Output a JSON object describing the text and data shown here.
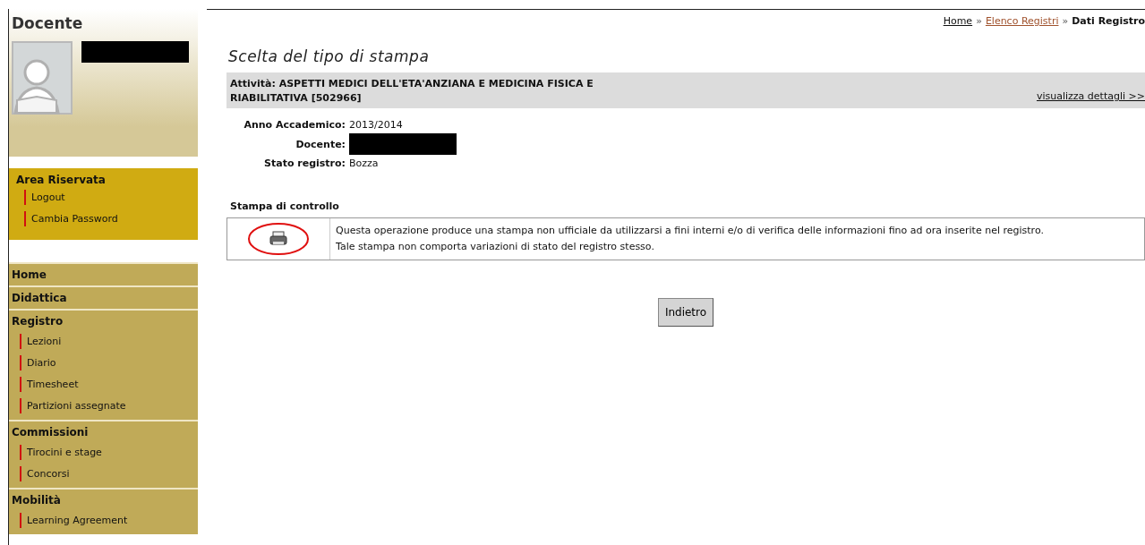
{
  "sidebar": {
    "title": "Docente",
    "reserved_area": {
      "title": "Area Riservata",
      "items": [
        "Logout",
        "Cambia Password"
      ]
    },
    "menu": [
      {
        "label": "Home"
      },
      {
        "label": "Didattica"
      },
      {
        "label": "Registro",
        "children": [
          "Lezioni",
          "Diario",
          "Timesheet",
          "Partizioni assegnate"
        ]
      },
      {
        "label": "Commissioni",
        "children": [
          "Tirocini e stage",
          "Concorsi"
        ]
      },
      {
        "label": "Mobilità",
        "children": [
          "Learning Agreement"
        ]
      }
    ]
  },
  "breadcrumb": [
    {
      "label": "Home",
      "kind": "link"
    },
    {
      "label": "Elenco Registri",
      "kind": "visited"
    },
    {
      "label": "Dati Registro",
      "kind": "current"
    }
  ],
  "breadcrumb_separator": "»",
  "page_title": "Scelta del tipo di stampa",
  "activity": {
    "text": "Attività: ASPETTI MEDICI DELL'ETA'ANZIANA E MEDICINA FISICA E RIABILITATIVA [502966]",
    "details_link": "visualizza dettagli >>"
  },
  "fields": [
    {
      "label": "Anno Accademico:",
      "value": "2013/2014"
    },
    {
      "label": "Docente:"
    },
    {
      "label": "Stato registro:",
      "value": "Bozza"
    }
  ],
  "print_section": {
    "title": "Stampa di controllo",
    "description": [
      "Questa operazione produce una stampa non ufficiale da utilizzarsi a fini interni e/o di verifica delle informazioni fino ad ora inserite nel registro.",
      "Tale stampa non comporta variazioni di stato del registro stesso."
    ]
  },
  "back_button": "Indietro"
}
